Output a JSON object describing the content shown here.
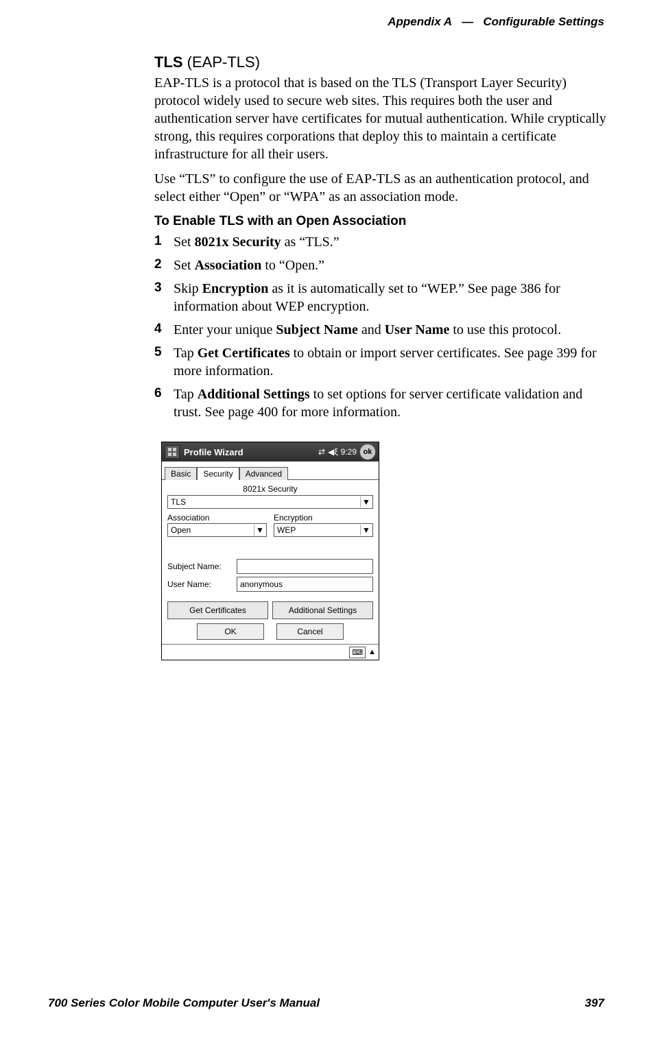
{
  "header": {
    "appendix": "Appendix A",
    "sep": "—",
    "title": "Configurable Settings"
  },
  "footer": {
    "manual": "700 Series Color Mobile Computer User's Manual",
    "page": "397"
  },
  "section": {
    "heading_bold": "TLS",
    "heading_rest": " (EAP-TLS)",
    "p1": "EAP-TLS is a protocol that is based on the TLS (Transport Layer Security) protocol widely used to secure web sites. This requires both the user and authentication server have certificates for mutual authentication. While cryptically strong, this requires corporations that deploy this to maintain a certificate infrastructure for all their users.",
    "p2": "Use “TLS” to configure the use of EAP-TLS as an authentication protocol, and select either “Open” or “WPA” as an association mode."
  },
  "subheading": "To Enable TLS with an Open Association",
  "steps": {
    "s1_a": "Set ",
    "s1_b": "8021x Security",
    "s1_c": " as “TLS.”",
    "s2_a": "Set ",
    "s2_b": "Association",
    "s2_c": " to “Open.”",
    "s3_a": "Skip ",
    "s3_b": "Encryption",
    "s3_c": " as it is automatically set to “WEP.” See page 386 for information about WEP encryption.",
    "s4_a": "Enter your unique ",
    "s4_b": "Subject Name",
    "s4_c": " and ",
    "s4_d": "User Name",
    "s4_e": " to use this protocol.",
    "s5_a": "Tap ",
    "s5_b": "Get Certificates",
    "s5_c": " to obtain or import server certificates. See page 399 for more information.",
    "s6_a": "Tap ",
    "s6_b": "Additional Settings",
    "s6_c": " to set options for server certificate validation and trust. See page 400 for more information."
  },
  "device": {
    "title": "Profile Wizard",
    "time": "9:29",
    "ok": "ok",
    "tabs": {
      "basic": "Basic",
      "security": "Security",
      "advanced": "Advanced"
    },
    "sec_label": "8021x Security",
    "security_value": "TLS",
    "assoc_label": "Association",
    "assoc_value": "Open",
    "enc_label": "Encryption",
    "enc_value": "WEP",
    "subject_label": "Subject Name:",
    "subject_value": "",
    "user_label": "User Name:",
    "user_value": "anonymous",
    "getcert": "Get Certificates",
    "addl": "Additional Settings",
    "okbtn": "OK",
    "cancel": "Cancel"
  }
}
